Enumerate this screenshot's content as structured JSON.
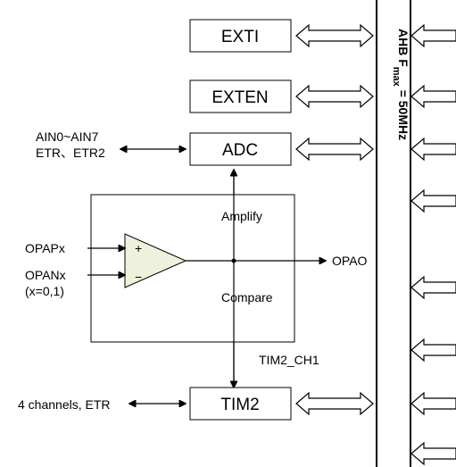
{
  "bus": {
    "label": "AHB  F",
    "sub": "max",
    "eq": " = 50MHz"
  },
  "blocks": {
    "exti": "EXTI",
    "exten": "EXTEN",
    "adc": "ADC",
    "tim2": "TIM2"
  },
  "adc_pins": {
    "line1": "AIN0~AIN7",
    "line2": "ETR、ETR2"
  },
  "opamp": {
    "p_in": "OPAPx",
    "n_in": "OPANx",
    "n_note": "(x=0,1)",
    "out": "OPAO",
    "amp_lbl": "Amplify",
    "cmp_lbl": "Compare",
    "plus": "+",
    "minus": "−"
  },
  "tim2_ch": "TIM2_CH1",
  "tim2_pins": "4 channels, ETR"
}
